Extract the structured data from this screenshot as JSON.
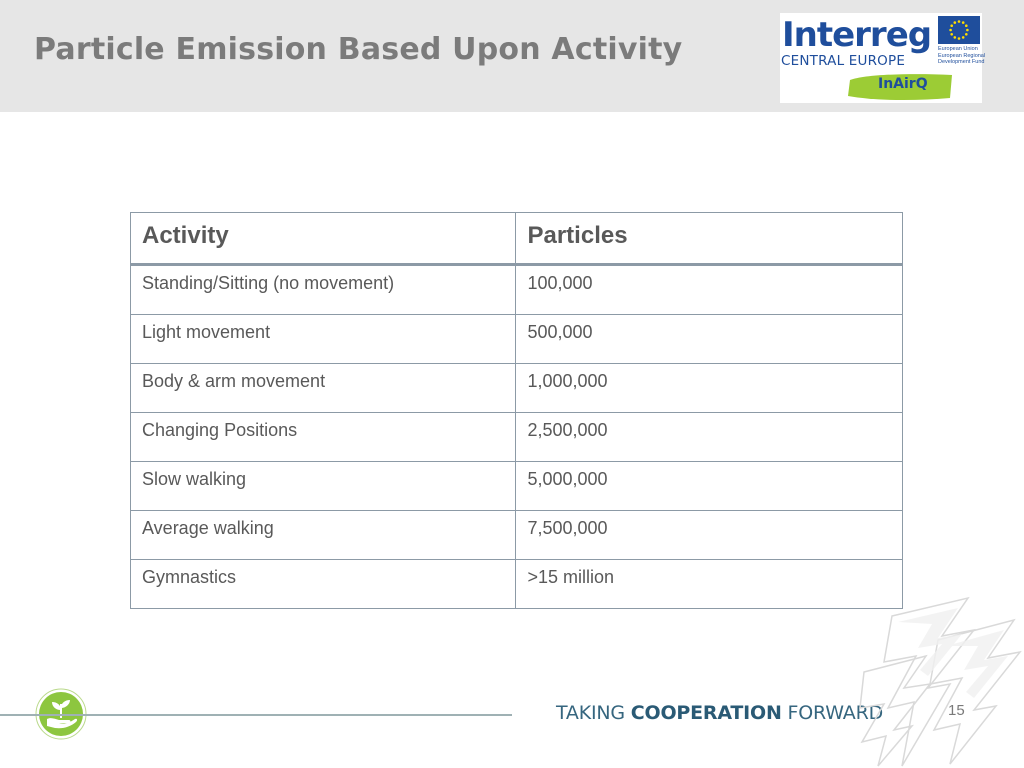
{
  "slide": {
    "title": "Particle Emission Based Upon Activity",
    "page_number": "15"
  },
  "logo": {
    "wordmark": "Interreg",
    "subtitle": "CENTRAL EUROPE",
    "eu_lines": [
      "European Union",
      "European Regional",
      "Development Fund"
    ],
    "project": "InAirQ",
    "brand_color": "#1f4e9c",
    "project_tag_color": "#9ccc35"
  },
  "table": {
    "headers": {
      "activity": "Activity",
      "particles": "Particles"
    },
    "rows": [
      {
        "activity": "Standing/Sitting (no movement)",
        "particles": "100,000"
      },
      {
        "activity": "Light movement",
        "particles": "500,000"
      },
      {
        "activity": "Body & arm movement",
        "particles": "1,000,000"
      },
      {
        "activity": "Changing Positions",
        "particles": "2,500,000"
      },
      {
        "activity": "Slow walking",
        "particles": "5,000,000"
      },
      {
        "activity": "Average walking",
        "particles": "7,500,000"
      },
      {
        "activity": "Gymnastics",
        "particles": ">15 million"
      }
    ]
  },
  "footer": {
    "tagline_part1": "TAKING ",
    "tagline_part2": "COOPERATION",
    "tagline_part3": " FORWARD",
    "icon": "leaf-hand-icon",
    "accent_color": "#8dc63f"
  }
}
